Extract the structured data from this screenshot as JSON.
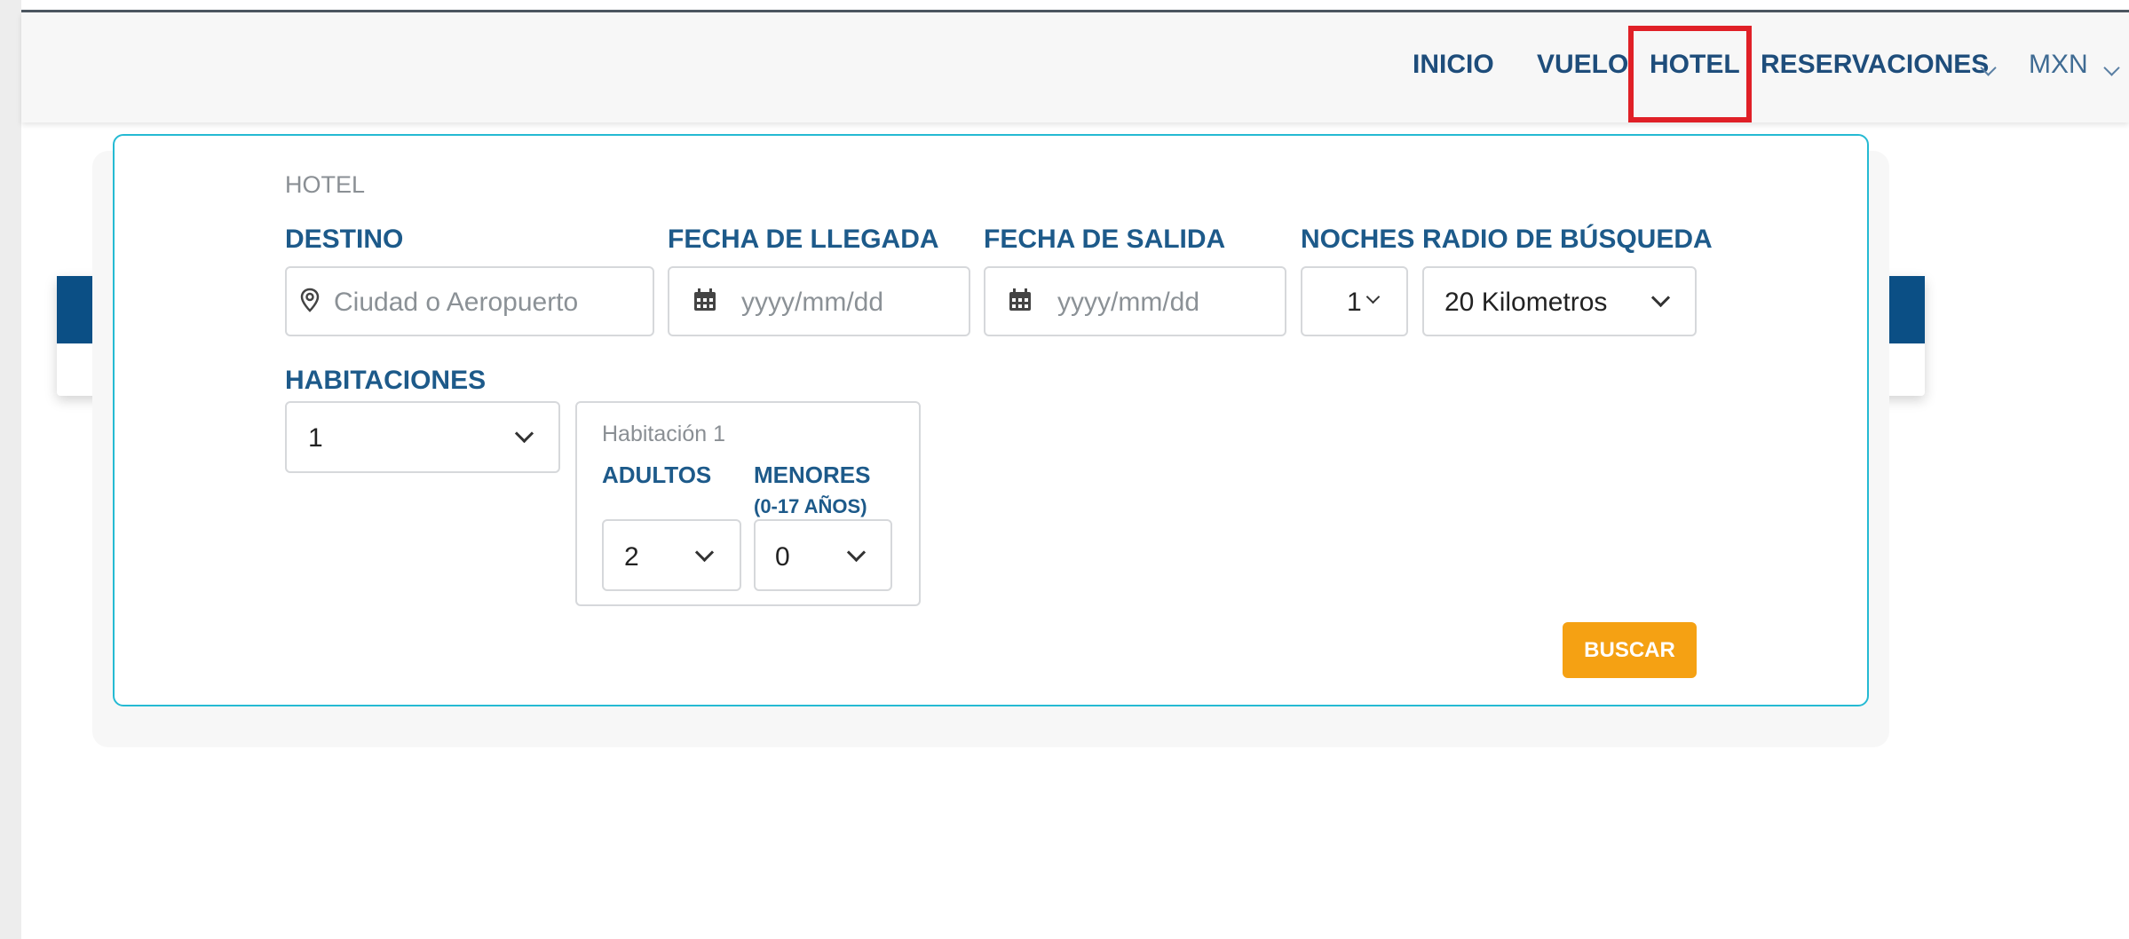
{
  "nav": {
    "inicio": "INICIO",
    "vuelo": "VUELO",
    "hotel": "HOTEL",
    "reservaciones": "RESERVACIONES",
    "currency": "MXN"
  },
  "search": {
    "section_title": "HOTEL",
    "destino_label": "DESTINO",
    "destino_placeholder": "Ciudad o Aeropuerto",
    "llegada_label": "FECHA DE LLEGADA",
    "llegada_placeholder": "yyyy/mm/dd",
    "salida_label": "FECHA DE SALIDA",
    "salida_placeholder": "yyyy/mm/dd",
    "noches_label": "NOCHES",
    "noches_value": "1",
    "radio_label": "RADIO DE BÚSQUEDA",
    "radio_value": "20 Kilometros",
    "habitaciones_label": "HABITACIONES",
    "habitaciones_value": "1",
    "room_title": "Habitación 1",
    "adultos_label": "ADULTOS",
    "adultos_value": "2",
    "menores_label": "MENORES",
    "menores_sub": "(0-17 AÑOS)",
    "menores_value": "0",
    "buscar_label": "BUSCAR"
  },
  "colors": {
    "accent_blue": "#1d5a8a",
    "popup_border": "#25bad3",
    "button_orange": "#f5a113",
    "highlight_red": "#e02027",
    "header_bar": "#0b4f85"
  },
  "icons": [
    "location-pin-icon",
    "calendar-icon",
    "chevron-down-icon",
    "red-arrow-annotation"
  ]
}
